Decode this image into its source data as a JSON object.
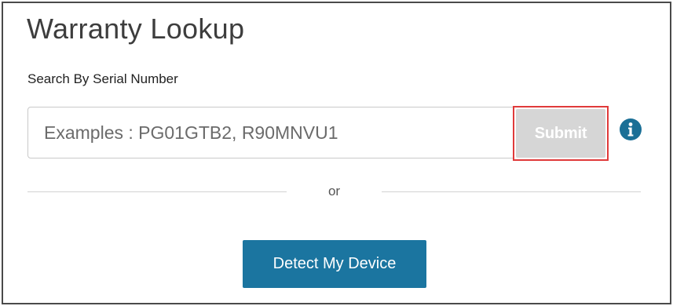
{
  "page": {
    "title": "Warranty Lookup"
  },
  "search": {
    "label": "Search By Serial Number",
    "placeholder": "Examples : PG01GTB2, R90MNVU1",
    "value": "",
    "submit_label": "Submit"
  },
  "info": {
    "icon": "info-icon"
  },
  "separator": {
    "text": "or"
  },
  "detect": {
    "label": "Detect My Device"
  },
  "colors": {
    "accent": "#1b75a0",
    "submit_bg": "#d6d6d6",
    "highlight_border": "#e03a3a",
    "frame_border": "#4a4a4a"
  }
}
